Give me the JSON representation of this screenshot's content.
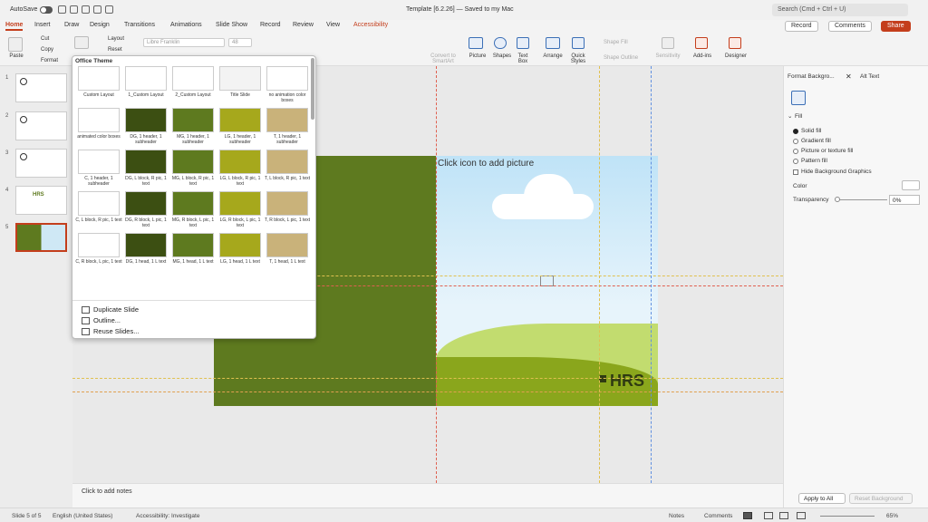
{
  "titlebar": {
    "autosave": "AutoSave",
    "title": "Template [6.2.26] — Saved to my Mac",
    "search_placeholder": "Search (Cmd + Ctrl + U)"
  },
  "tabs": [
    "Home",
    "Insert",
    "Draw",
    "Design",
    "Transitions",
    "Animations",
    "Slide Show",
    "Record",
    "Review",
    "View",
    "Accessibility"
  ],
  "tab_actions": {
    "record": "Record",
    "comments": "Comments",
    "share": "Share"
  },
  "ribbon": {
    "paste": "Paste",
    "cut": "Cut",
    "copy": "Copy",
    "format": "Format",
    "layout": "Layout",
    "reset": "Reset",
    "font": "Libre Franklin",
    "size": "48",
    "convert": "Convert to SmartArt",
    "picture": "Picture",
    "shapes": "Shapes",
    "textbox": "Text Box",
    "arrange": "Arrange",
    "quick_styles": "Quick Styles",
    "shape_fill": "Shape Fill",
    "shape_outline": "Shape Outline",
    "sensitivity": "Sensitivity",
    "addins": "Add-ins",
    "designer": "Designer"
  },
  "slides": [
    "1",
    "2",
    "3",
    "4",
    "5"
  ],
  "layout_panel": {
    "header": "Office Theme",
    "layouts": [
      "Custom Layout",
      "1_Custom Layout",
      "2_Custom Layout",
      "Title Slide",
      "no animation color boxes",
      "animated color boxes",
      "DG, 1 header, 1 subheader",
      "MG, 1 header, 1 subheader",
      "LG, 1 header, 1 subheader",
      "T, 1 header, 1 subheader",
      "C, 1 header, 1 subheader",
      "DG, L block, R pic, 1 text",
      "MG, L block, R pic, 1 text",
      "LG, L block, R pic, 1 text",
      "T, L block, R pic, 1 text",
      "C, L block, R pic, 1 text",
      "DG, R block, L pic, 1 text",
      "MG, R block, L pic, 1 text",
      "LG, R block, L pic, 1 text",
      "T, R block, L pic, 1 text",
      "C, R block, L pic, 1 text",
      "DG, 1 head, 1 L text",
      "MG, 1 head, 1 L text",
      "LG, 1 head, 1 L text",
      "T, 1 head, 1 L text"
    ],
    "menu": [
      "Duplicate Slide",
      "Outline...",
      "Reuse Slides..."
    ]
  },
  "slide": {
    "picture_placeholder": "Click icon to add picture",
    "logo": "HRS"
  },
  "thumb_logo": "HRS",
  "notes_placeholder": "Click to add notes",
  "pane": {
    "tab1": "Format Backgro...",
    "tab2": "Alt Text",
    "section": "Fill",
    "options": [
      "Solid fill",
      "Gradient fill",
      "Picture or texture fill",
      "Pattern fill"
    ],
    "hide_bg": "Hide Background Graphics",
    "color": "Color",
    "transparency": "Transparency",
    "transparency_value": "0%",
    "apply_all": "Apply to All",
    "reset_bg": "Reset Background"
  },
  "status": {
    "slide": "Slide 5 of 5",
    "language": "English (United States)",
    "accessibility": "Accessibility: Investigate",
    "notes": "Notes",
    "comments": "Comments",
    "zoom": "65%"
  },
  "colors": {
    "accent": "#c43e1c",
    "dark_green": "#5e7a1f",
    "light_green": "#8aa61c",
    "olive": "#a6a81c",
    "tan": "#c9b27a"
  }
}
